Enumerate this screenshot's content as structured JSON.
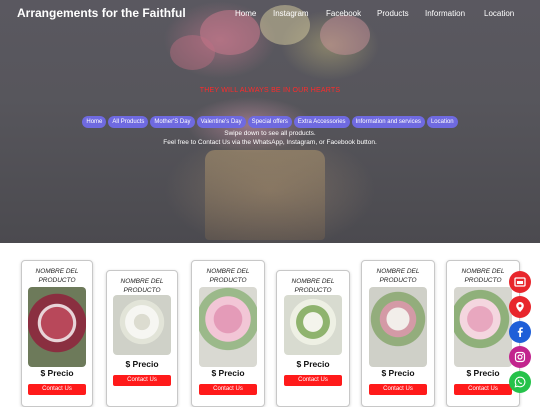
{
  "header": {
    "brand": "Arrangements for the Faithful",
    "nav": [
      "Home",
      "Instagram",
      "Facebook",
      "Products",
      "Information",
      "Location"
    ]
  },
  "hero": {
    "tagline": "THEY WILL ALWAYS BE IN OUR HEARTS",
    "pills": [
      "Home",
      "All Products",
      "Mother'S Day",
      "Valentine's Day",
      "Special offers",
      "Extra Accessories",
      "Information and services",
      "Location"
    ],
    "line1": "Swipe down to see all products.",
    "line2": "Feel free to Contact Us via the WhatsApp, Instagram, or Facebook button."
  },
  "products": [
    {
      "name": "NOMBRE DEL PRODUCTO",
      "price": "$ Precio",
      "button": "Contact Us"
    },
    {
      "name": "NOMBRE DEL PRODUCTO",
      "price": "$ Precio",
      "button": "Contact Us"
    },
    {
      "name": "NOMBRE DEL PRODUCTO",
      "price": "$ Precio",
      "button": "Contact Us"
    },
    {
      "name": "NOMBRE DEL PRODUCTO",
      "price": "$ Precio",
      "button": "Contact Us"
    },
    {
      "name": "NOMBRE DEL PRODUCTO",
      "price": "$ Precio",
      "button": "Contact Us"
    },
    {
      "name": "NOMBRE DEL PRODUCTO",
      "price": "$ Precio",
      "button": "Contact Us"
    }
  ],
  "floating_buttons": [
    {
      "icon": "store-icon",
      "color": "#e8262c"
    },
    {
      "icon": "location-pin-icon",
      "color": "#e8262c"
    },
    {
      "icon": "facebook-icon",
      "color": "#1f5fd8"
    },
    {
      "icon": "instagram-icon",
      "color": "#c2248e"
    },
    {
      "icon": "whatsapp-icon",
      "color": "#25c24a"
    }
  ],
  "colors": {
    "accent_red": "#ff1a1a",
    "pill_purple": "#6f6ae0",
    "tagline_red": "#ff2a2a"
  }
}
